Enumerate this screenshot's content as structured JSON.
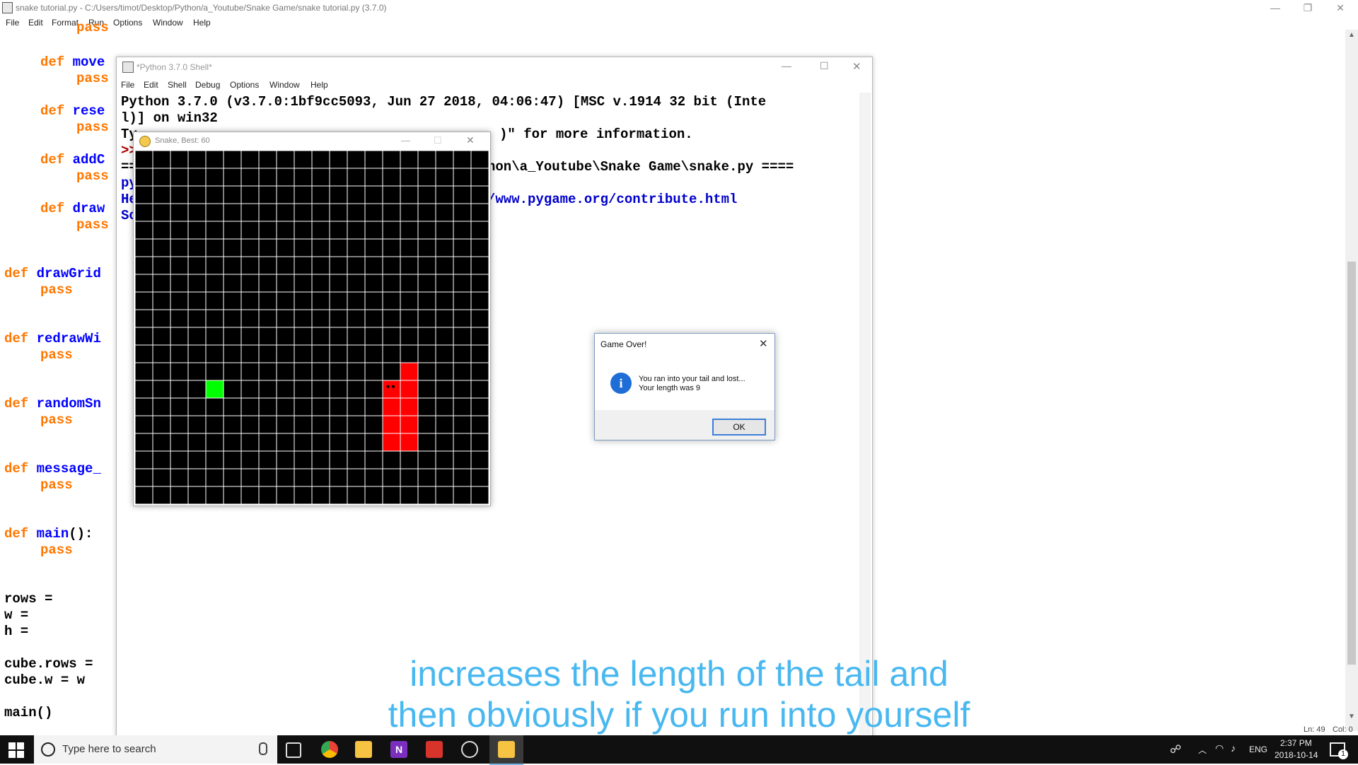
{
  "editor": {
    "title": "snake tutorial.py - C:/Users/timot/Desktop/Python/a_Youtube/Snake Game/snake tutorial.py (3.7.0)",
    "menu": [
      "File",
      "Edit",
      "Format",
      "Run",
      "Options",
      "Window",
      "Help"
    ],
    "code_lines": [
      {
        "indent": "    ",
        "kw": "",
        "rest": "pass",
        "partial": true
      },
      {
        "indent": "    ",
        "kw": "def",
        "fn": "move",
        "rest": ""
      },
      {
        "indent": "        ",
        "kw": "pass",
        "rest": ""
      },
      {
        "indent": "    ",
        "kw": "def",
        "fn": "rese",
        "rest": ""
      },
      {
        "indent": "        ",
        "kw": "pass",
        "rest": ""
      },
      {
        "indent": "    ",
        "kw": "def",
        "fn": "addC",
        "rest": ""
      },
      {
        "indent": "        ",
        "kw": "pass",
        "rest": ""
      },
      {
        "indent": "    ",
        "kw": "def",
        "fn": "draw",
        "rest": ""
      },
      {
        "indent": "        ",
        "kw": "pass",
        "rest": ""
      },
      {
        "indent": "",
        "kw": "def",
        "fn": "drawGrid",
        "rest": ""
      },
      {
        "indent": "    ",
        "kw": "pass",
        "rest": ""
      },
      {
        "indent": "",
        "kw": "def",
        "fn": "redrawWi",
        "rest": ""
      },
      {
        "indent": "    ",
        "kw": "pass",
        "rest": ""
      },
      {
        "indent": "",
        "kw": "def",
        "fn": "randomSn",
        "rest": ""
      },
      {
        "indent": "    ",
        "kw": "pass",
        "rest": ""
      },
      {
        "indent": "",
        "kw": "def",
        "fn": "message_",
        "rest": ""
      },
      {
        "indent": "    ",
        "kw": "pass",
        "rest": ""
      },
      {
        "indent": "",
        "kw": "def",
        "fn": "main",
        "rest": "():"
      },
      {
        "indent": "    ",
        "kw": "pass",
        "rest": ""
      },
      {
        "indent": "",
        "kw": "",
        "rest": "rows ="
      },
      {
        "indent": "",
        "kw": "",
        "rest": "w ="
      },
      {
        "indent": "",
        "kw": "",
        "rest": "h ="
      },
      {
        "indent": "",
        "kw": "",
        "rest": "cube.rows ="
      },
      {
        "indent": "",
        "kw": "",
        "rest": "cube.w = w"
      },
      {
        "indent": "",
        "kw": "",
        "rest": "main()"
      }
    ],
    "status": {
      "line": "Ln: 49",
      "col": "Col: 0"
    }
  },
  "shell": {
    "title": "*Python 3.7.0 Shell*",
    "menu": [
      "File",
      "Edit",
      "Shell",
      "Debug",
      "Options",
      "Window",
      "Help"
    ],
    "lines": [
      "Python 3.7.0 (v3.7.0:1bf9cc5093, Jun 27 2018, 04:06:47) [MSC v.1914 32 bit (Inte",
      "l)] on win32",
      "Ty",
      ">>",
      "==",
      "py",
      "He",
      "So"
    ],
    "right_fragments": [
      ")\" for more information.",
      "hon\\a_Youtube\\Snake Game\\snake.py ====",
      "/www.pygame.org/contribute.html"
    ]
  },
  "snake_window": {
    "title": "Snake, Best: 60",
    "grid": {
      "rows": 20,
      "cols": 20
    },
    "snack": {
      "row": 13,
      "col": 4,
      "color": "#00ff00"
    },
    "snake_cells": [
      [
        12,
        15
      ],
      [
        13,
        14
      ],
      [
        13,
        15
      ],
      [
        14,
        14
      ],
      [
        14,
        15
      ],
      [
        15,
        14
      ],
      [
        15,
        15
      ],
      [
        16,
        14
      ],
      [
        16,
        15
      ]
    ],
    "snake_color": "#ff0000",
    "head": [
      13,
      14
    ]
  },
  "dialog": {
    "title": "Game Over!",
    "message_line1": "You ran into your tail and lost...",
    "message_line2": "Your length was 9",
    "ok_label": "OK",
    "icon": "info-icon"
  },
  "subtitle": {
    "line1": "increases the length of the tail and",
    "line2": "then obviously if you run into yourself"
  },
  "taskbar": {
    "search_placeholder": "Type here to search",
    "language": "ENG",
    "time": "2:37 PM",
    "date": "2018-10-14",
    "notification_count": "1",
    "apps": [
      "task-view-icon",
      "chrome-icon",
      "file-explorer-icon",
      "onenote-icon",
      "acrobat-icon",
      "obs-icon",
      "idle-icon"
    ]
  }
}
